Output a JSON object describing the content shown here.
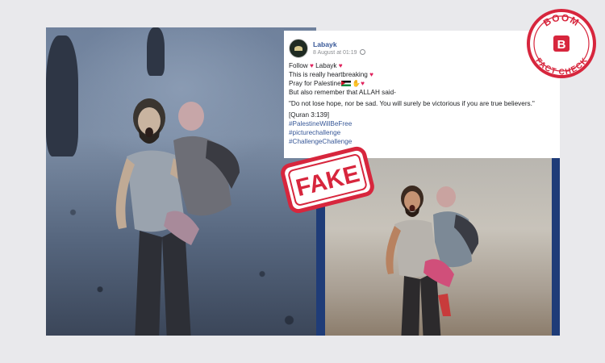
{
  "post": {
    "author": "Labayk",
    "timestamp": "8 August at 01:19",
    "lines": {
      "follow_prefix": "Follow ",
      "follow_name": " Labayk ",
      "heartbreaking": "This is really heartbreaking ",
      "pray": "Pray for Palestine",
      "remember": "But also remember that ALLAH said-",
      "quote": "\"Do not lose hope, nor be sad. You will surely be victorious if you are true believers.\"",
      "reference": "[Quran 3:139]",
      "hashtag_1": "#PalestineWillBeFree",
      "hashtag_2": "#picturechallenge",
      "hashtag_3": "#ChallengeChallenge"
    },
    "icons": {
      "heart": "heart-icon",
      "flag": "palestine-flag-icon",
      "globe": "globe-icon"
    }
  },
  "stamp": {
    "label": "FAKE",
    "color": "#d7263d"
  },
  "badge": {
    "top_text": "BOOM",
    "bottom_text": "FACT CHECK",
    "letter": "B",
    "color": "#d7263d"
  },
  "colors": {
    "link_blue": "#385898",
    "frame_blue": "#1f3c78"
  }
}
